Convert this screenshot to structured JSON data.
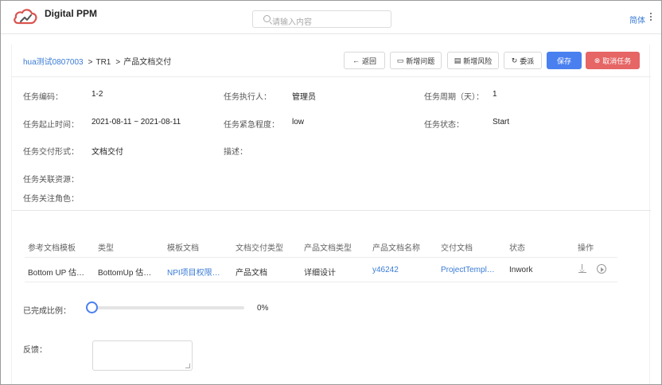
{
  "header": {
    "brand": "Digital PPM",
    "search_placeholder": "请输入内容",
    "language": "简体"
  },
  "breadcrumb": {
    "project": "hua测试0807003",
    "stage": "TR1",
    "current": "产品文档交付"
  },
  "toolbar": {
    "back": "返回",
    "new_issue": "新增问题",
    "new_risk": "新增风险",
    "delegate": "委派",
    "save": "保存",
    "cancel_task": "取消任务"
  },
  "task": {
    "code_label": "任务编码：",
    "code": "1-2",
    "executor_label": "任务执行人：",
    "executor": "管理员",
    "period_label": "任务周期（天）：",
    "period": "1",
    "dates_label": "任务起止时间：",
    "dates": "2021-08-11 ~ 2021-08-11",
    "urgency_label": "任务紧急程度：",
    "urgency": "low",
    "status_label": "任务状态：",
    "status": "Start",
    "delivery_label": "任务交付形式：",
    "delivery": "文档交付",
    "description_label": "描述：",
    "resources_label": "任务关联资源：",
    "roles_label": "任务关注角色："
  },
  "table": {
    "headers": [
      "参考文档模板",
      "类型",
      "模板文档",
      "文档交付类型",
      "产品文档类型",
      "产品文档名称",
      "交付文档",
      "状态",
      "操作"
    ],
    "rows": [
      [
        "Bottom UP 估…",
        "BottomUp 估…",
        "NPI项目权限…",
        "产品文档",
        "详细设计",
        "y46242",
        "ProjectTempl…",
        "Inwork"
      ]
    ]
  },
  "progress": {
    "label": "已完成比例：",
    "value_text": "0%",
    "fraction": 0
  },
  "feedback": {
    "label": "反馈："
  },
  "colors": {
    "primary": "#4a7ff0",
    "danger": "#e66565",
    "link": "#3a7bd5"
  }
}
